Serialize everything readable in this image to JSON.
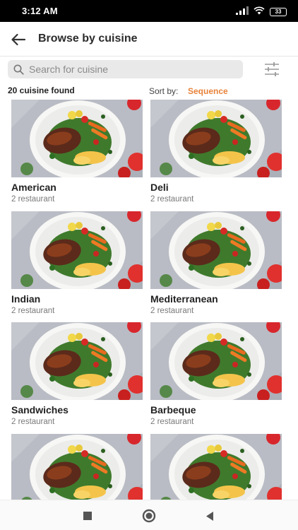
{
  "status_bar": {
    "time": "3:12 AM",
    "battery": "33"
  },
  "app_bar": {
    "title": "Browse by cuisine"
  },
  "search": {
    "placeholder": "Search for cuisine",
    "value": ""
  },
  "results": {
    "count_label": "20 cuisine found",
    "sort_label": "Sort by:",
    "sort_value": "Sequence"
  },
  "cuisines": [
    {
      "name": "American",
      "subtitle": "2 restaurant"
    },
    {
      "name": "Deli",
      "subtitle": "2 restaurant"
    },
    {
      "name": "Indian",
      "subtitle": "2 restaurant"
    },
    {
      "name": "Mediterranean",
      "subtitle": "2 restaurant"
    },
    {
      "name": "Sandwiches",
      "subtitle": "2 restaurant"
    },
    {
      "name": "Barbeque",
      "subtitle": "2 restaurant"
    },
    {
      "name": "",
      "subtitle": ""
    },
    {
      "name": "",
      "subtitle": ""
    }
  ],
  "colors": {
    "accent": "#e8823a",
    "search_bg": "#e9e9e9",
    "status_bar": "#000000"
  },
  "icons": {
    "back": "arrow-left-icon",
    "search": "search-icon",
    "filter": "sliders-icon",
    "nav_recents": "square-icon",
    "nav_home": "circle-icon",
    "nav_back": "triangle-back-icon",
    "card_image": "grilled-chicken-salad-photo"
  }
}
